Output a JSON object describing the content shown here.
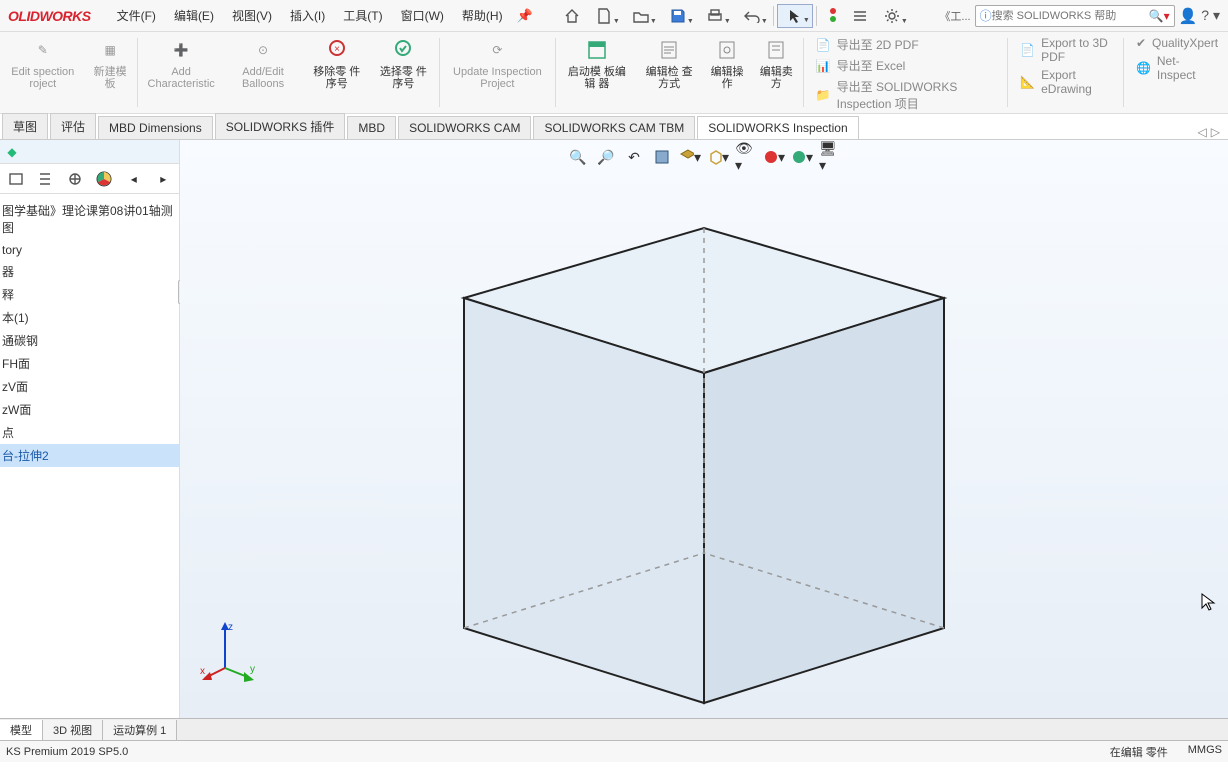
{
  "app": {
    "logo": "OLIDWORKS"
  },
  "menu": {
    "file": "文件(F)",
    "edit": "编辑(E)",
    "view": "视图(V)",
    "insert": "插入(I)",
    "tools": "工具(T)",
    "window": "窗口(W)",
    "help": "帮助(H)"
  },
  "search": {
    "placeholder": "搜索 SOLIDWORKS 帮助",
    "prefix_btn": "《工..."
  },
  "ribbon": {
    "edit_inspection": "Edit\nspection\nroject",
    "new_template": "新建模\n板",
    "add_characteristic": "Add\nCharacteristic",
    "add_edit_balloons": "Add/Edit\nBalloons",
    "remove_balloon": "移除零\n件序号",
    "select_balloon": "选择零\n件序号",
    "update_inspection": "Update\nInspection\nProject",
    "template_editor": "启动模\n板编辑\n器",
    "edit_inspection_method": "编辑检\n查方式",
    "edit_operation": "编辑操\n作",
    "edit_vendor": "编辑卖\n方",
    "export_2d_pdf": "导出至 2D PDF",
    "export_excel": "导出至 Excel",
    "export_sw_inspection": "导出至 SOLIDWORKS Inspection 项目",
    "export_3d_pdf": "Export to 3D PDF",
    "export_edrawing": "Export eDrawing",
    "qualityxpert": "QualityXpert",
    "net_inspect": "Net-Inspect"
  },
  "tabs": {
    "sketch": "草图",
    "evaluate": "评估",
    "mbd": "MBD Dimensions",
    "addins": "SOLIDWORKS 插件",
    "mbd2": "MBD",
    "cam": "SOLIDWORKS CAM",
    "cam_tbm": "SOLIDWORKS CAM TBM",
    "inspection": "SOLIDWORKS Inspection"
  },
  "tree": {
    "title": "图学基础》理论课第08讲01轴测图",
    "items": [
      "tory",
      "器",
      "释",
      "本(1)",
      "通碳钢",
      "FH面",
      "zV面",
      "zW面",
      "点",
      "台-拉伸2"
    ],
    "selected_index": 9
  },
  "triad": {
    "x": "x",
    "y": "y",
    "z": "z"
  },
  "bottom_tabs": {
    "model": "模型",
    "view3d": "3D 视图",
    "motion": "运动算例 1"
  },
  "status": {
    "version": "KS Premium 2019 SP5.0",
    "editing": "在编辑 零件",
    "units": "MMGS"
  }
}
